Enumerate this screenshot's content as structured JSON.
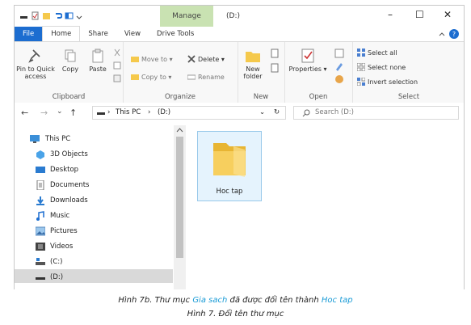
{
  "window": {
    "title": "(D:)",
    "manage_tab": "Manage",
    "controls": {
      "minimize": "–",
      "maximize": "☐",
      "close": "✕"
    }
  },
  "tabs": {
    "file": "File",
    "home": "Home",
    "share": "Share",
    "view": "View",
    "drive_tools": "Drive Tools"
  },
  "ribbon": {
    "clipboard": {
      "label": "Clipboard",
      "pin": "Pin to Quick access",
      "copy": "Copy",
      "paste": "Paste"
    },
    "organize": {
      "label": "Organize",
      "move_to": "Move to ▾",
      "copy_to": "Copy to ▾",
      "delete": "Delete ▾",
      "rename": "Rename"
    },
    "new": {
      "label": "New",
      "new_folder": "New folder"
    },
    "open": {
      "label": "Open",
      "properties": "Properties ▾"
    },
    "select": {
      "label": "Select",
      "select_all": "Select all",
      "select_none": "Select none",
      "invert": "Invert selection"
    }
  },
  "address": {
    "back": "←",
    "forward": "→",
    "recent": "⌄",
    "up": "↑",
    "path_this_pc": "This PC",
    "path_drive": "(D:)",
    "search_placeholder": "Search (D:)",
    "refresh": "↻",
    "dropdown": "⌄"
  },
  "nav_items": [
    {
      "label": "This PC",
      "icon": "pc-icon"
    },
    {
      "label": "3D Objects",
      "icon": "cube-icon"
    },
    {
      "label": "Desktop",
      "icon": "desktop-icon"
    },
    {
      "label": "Documents",
      "icon": "documents-icon"
    },
    {
      "label": "Downloads",
      "icon": "download-icon"
    },
    {
      "label": "Music",
      "icon": "music-icon"
    },
    {
      "label": "Pictures",
      "icon": "pictures-icon"
    },
    {
      "label": "Videos",
      "icon": "videos-icon"
    },
    {
      "label": "(C:)",
      "icon": "drive-icon"
    },
    {
      "label": "(D:)",
      "icon": "drive-icon",
      "selected": true
    }
  ],
  "content": {
    "folder_name": "Hoc tap"
  },
  "caption": {
    "line1_pre": "Hình 7b. Thư mục ",
    "line1_old": "Gia sach",
    "line1_mid": " đã được đổi tên thành ",
    "line1_new": "Hoc tap",
    "line2": "Hình 7. Đổi tên thư mục"
  },
  "colors": {
    "file_tab": "#1c6dd0",
    "manage_tab": "#c9e2b2",
    "caption_highlight": "#1a9bd6",
    "folder": "#f5c94c"
  }
}
